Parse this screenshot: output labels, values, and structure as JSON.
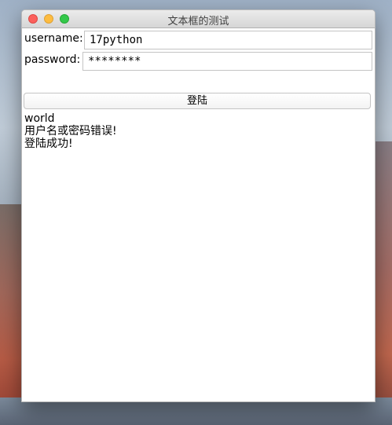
{
  "window": {
    "title": "文本框的测试"
  },
  "form": {
    "username_label": "username:",
    "username_value": "17python",
    "password_label": "password:",
    "password_value": "********",
    "login_label": "登陆"
  },
  "output": {
    "lines": [
      "world",
      "用户名或密码错误!",
      "登陆成功!"
    ]
  },
  "colors": {
    "close": "#fc605c",
    "minimize": "#fdbc40",
    "maximize": "#34c84a"
  }
}
